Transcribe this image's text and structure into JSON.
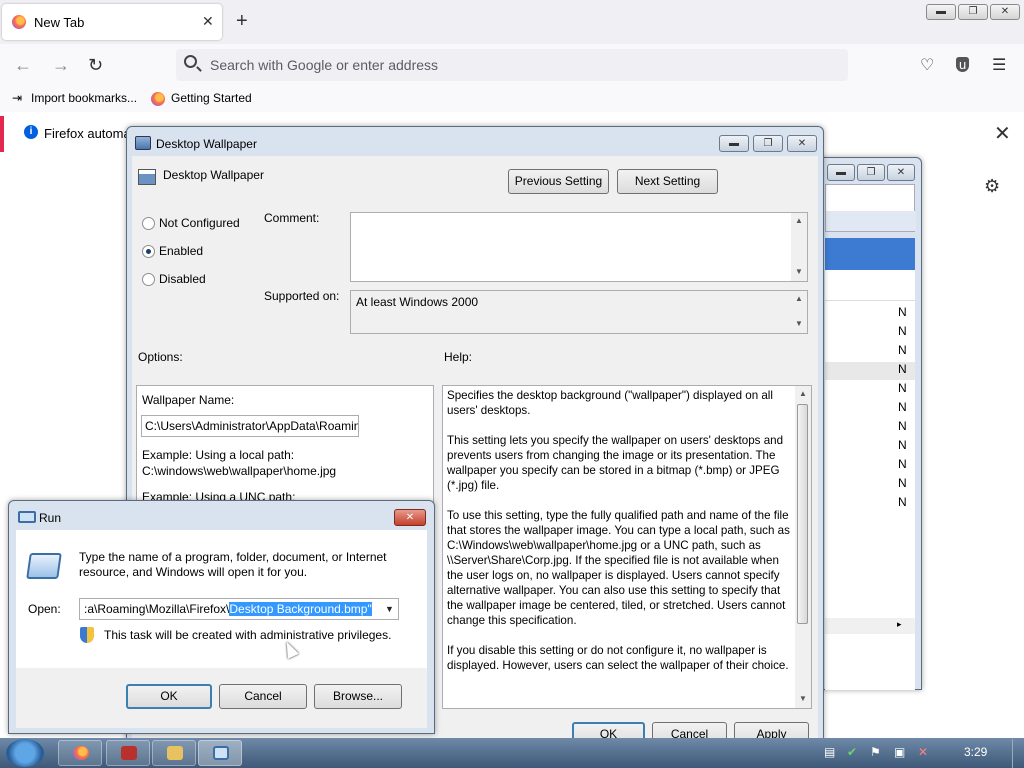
{
  "browser": {
    "tab_title": "New Tab",
    "tab_close": "✕",
    "new_tab": "+",
    "url_placeholder": "Search with Google or enter address",
    "bookmarks": [
      "Import bookmarks...",
      "Getting Started"
    ],
    "notification_text": "Firefox automat",
    "notification_close": "✕",
    "icons": [
      "firefox-icon",
      "back-icon",
      "forward-icon",
      "reload-icon",
      "search-icon",
      "pocket-icon",
      "ublock-icon",
      "menu-icon",
      "gear-icon"
    ]
  },
  "os_controls": {
    "minimize": "▬",
    "restore": "❐",
    "close": "✕"
  },
  "policy_dialog": {
    "title": "Desktop Wallpaper",
    "setting_name": "Desktop Wallpaper",
    "previous_setting": "Previous Setting",
    "next_setting": "Next Setting",
    "radio_not_configured": "Not Configured",
    "radio_enabled": "Enabled",
    "radio_disabled": "Disabled",
    "selected": "Enabled",
    "comment_label": "Comment:",
    "supported_label": "Supported on:",
    "supported_value": "At least Windows 2000",
    "options_label": "Options:",
    "help_label": "Help:",
    "wallpaper_name_label": "Wallpaper Name:",
    "wallpaper_name_value": "C:\\Users\\Administrator\\AppData\\Roamin",
    "example_local_1": "Example: Using a local path:",
    "example_local_2": "C:\\windows\\web\\wallpaper\\home.jpg",
    "example_unc": "Example: Using a UNC path:",
    "help_paragraphs": [
      "Specifies the desktop background (\"wallpaper\") displayed on all users' desktops.",
      "This setting lets you specify the wallpaper on users' desktops and prevents users from changing the image or its presentation. The wallpaper you specify can be stored in a bitmap (*.bmp) or JPEG (*.jpg) file.",
      "To use this setting, type the fully qualified path and name of the file that stores the wallpaper image. You can type a local path, such as C:\\Windows\\web\\wallpaper\\home.jpg or a UNC path, such as \\\\Server\\Share\\Corp.jpg. If the specified file is not available when the user logs on, no wallpaper is displayed. Users cannot specify alternative wallpaper. You can also use this setting to specify that the wallpaper image be centered, tiled, or stretched. Users cannot change this specification.",
      "If you disable this setting or do not configure it, no wallpaper is displayed. However, users can select the wallpaper of their choice."
    ],
    "ok": "OK",
    "cancel": "Cancel",
    "apply": "Apply"
  },
  "background_window": {
    "row_values": [
      "N",
      "N",
      "N",
      "N",
      "N",
      "N",
      "N",
      "N",
      "N",
      "N",
      "N"
    ]
  },
  "run_dialog": {
    "title": "Run",
    "description": "Type the name of a program, folder, document, or Internet resource, and Windows will open it for you.",
    "open_label": "Open:",
    "open_value_prefix": ":a\\Roaming\\Mozilla\\Firefox\\",
    "open_value_selected": "Desktop Background.bmp\"",
    "admin_note": "This task will be created with administrative privileges.",
    "ok": "OK",
    "cancel": "Cancel",
    "browse": "Browse..."
  },
  "taskbar": {
    "time": "3:29",
    "buttons": [
      "firefox",
      "app-red",
      "explorer",
      "run"
    ]
  }
}
